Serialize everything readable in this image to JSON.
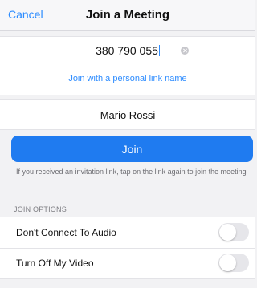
{
  "nav": {
    "cancel_label": "Cancel",
    "title": "Join a Meeting"
  },
  "meeting_id": {
    "value": "380 790 055",
    "clear_icon": "clear-circle-icon"
  },
  "personal_link": {
    "label": "Join with a personal link name"
  },
  "name_field": {
    "value": "Mario Rossi"
  },
  "join_button": {
    "label": "Join"
  },
  "hint_text": "If you received an invitation link, tap on the link again to join the meeting",
  "options": {
    "section_label": "JOIN OPTIONS",
    "items": [
      {
        "label": "Don't Connect To Audio",
        "on": false
      },
      {
        "label": "Turn Off My Video",
        "on": false
      }
    ]
  },
  "colors": {
    "accent": "#2d8cff",
    "join_button": "#1f7bf0",
    "background": "#f2f2f4"
  }
}
